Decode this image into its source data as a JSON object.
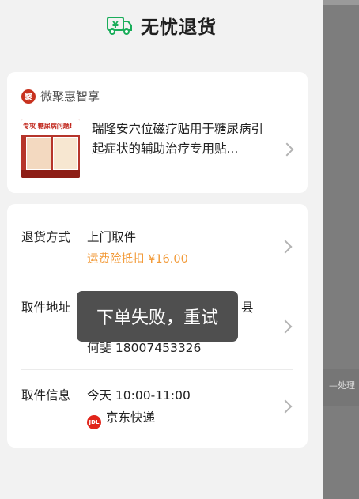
{
  "header": {
    "title": "无忧退货",
    "icon": "truck-yuan-icon",
    "accent_color": "#1aad5a"
  },
  "store": {
    "name": "微聚惠智享",
    "logo_text": "聚"
  },
  "product": {
    "title": "瑞隆安穴位磁疗贴用于糖尿病引起症状的辅助治疗专用贴...",
    "thumb_caption": "专攻 糖尿病问题!"
  },
  "return": {
    "method_label": "退货方式",
    "method_value": "上门取件",
    "insurance_text": "运费险抵扣 ¥16.00",
    "insurance_color": "#f29a38",
    "address_label": "取件地址",
    "address_line_partial": "县",
    "address_contact": "何斐 18007453326",
    "info_label": "取件信息",
    "pickup_time": "今天 10:00-11:00",
    "courier": "京东快递",
    "courier_logo_text": "JDL"
  },
  "toast": {
    "message": "下单失败，重试"
  },
  "background_panel": {
    "text": "—处理"
  }
}
